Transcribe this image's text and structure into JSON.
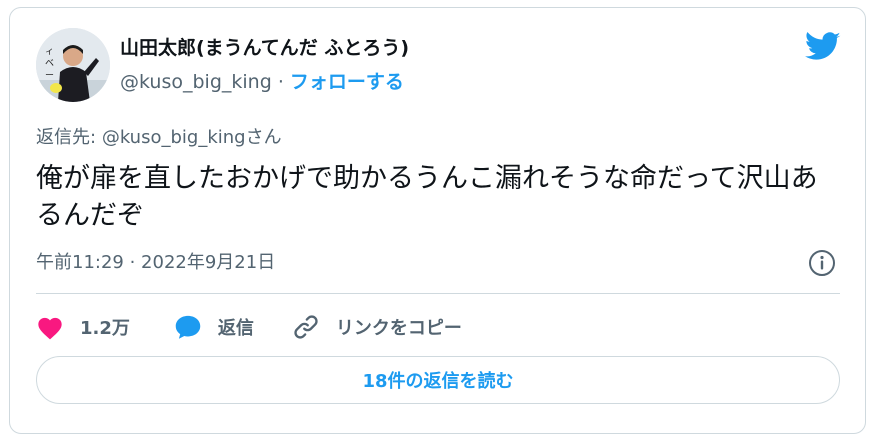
{
  "author": {
    "display_name": "山田太郎(まうんてんだ ふとろう)",
    "handle": "@kuso_big_king",
    "separator": "·",
    "follow_label": "フォローする",
    "avatar_icon": "profile-photo"
  },
  "reply_to": {
    "prefix": "返信先:",
    "mention": "@kuso_big_king",
    "suffix": "さん"
  },
  "tweet": {
    "text": "俺が扉を直したおかげで助かるうんこ漏れそうな命だって沢山あるんだぞ",
    "timestamp": "午前11:29 · 2022年9月21日"
  },
  "actions": {
    "like_count": "1.2万",
    "reply_label": "返信",
    "copy_link_label": "リンクをコピー"
  },
  "read_replies_label": "18件の返信を読む",
  "icons": {
    "brand": "twitter-bird-icon",
    "info": "info-icon",
    "like": "heart-icon",
    "reply": "speech-bubble-icon",
    "link": "link-icon"
  },
  "colors": {
    "accent": "#1d9bf0",
    "like": "#f91880",
    "text_primary": "#0f1419",
    "text_secondary": "#536471",
    "border": "#cfd9de"
  }
}
